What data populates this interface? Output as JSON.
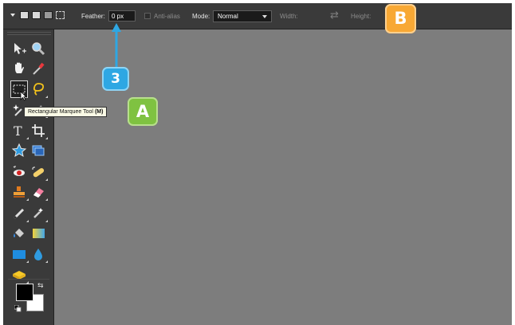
{
  "options_bar": {
    "feather_label": "Feather:",
    "feather_value": "0 px",
    "antialias_label": "Anti-alias",
    "mode_label": "Mode:",
    "mode_value": "Normal",
    "width_label": "Width:",
    "height_label": "Height:",
    "icons": [
      "dropdown-arrow-icon",
      "new-selection-icon",
      "add-to-selection-icon",
      "subtract-from-selection-icon",
      "intersect-selection-icon",
      "swap-dimensions-icon"
    ]
  },
  "toolbox": {
    "tools": [
      "move-tool",
      "zoom-tool",
      "hand-tool",
      "eyedropper-tool",
      "rectangular-marquee-tool",
      "lasso-tool",
      "magic-wand-tool",
      "brush-selection-tool",
      "type-tool",
      "crop-tool",
      "cookie-cutter-tool",
      "straighten-tool",
      "red-eye-tool",
      "spot-healing-tool",
      "clone-stamp-tool",
      "eraser-tool",
      "pencil-tool",
      "smart-brush-tool",
      "paint-bucket-tool",
      "gradient-tool",
      "shape-tool",
      "blur-tool",
      "sponge-tool"
    ],
    "active_tool": "rectangular-marquee-tool",
    "foreground_color": "#000000",
    "background_color": "#ffffff"
  },
  "tooltip": {
    "name": "Rectangular Marquee Tool",
    "shortcut": "(M)"
  },
  "callouts": {
    "step": "3",
    "a": "A",
    "b": "B"
  },
  "colors": {
    "workspace": "#7d7d7d",
    "panel": "#3a3a3a",
    "callout_blue": "#2ea7e3",
    "callout_green": "#7fc241",
    "callout_orange": "#f8a834"
  }
}
